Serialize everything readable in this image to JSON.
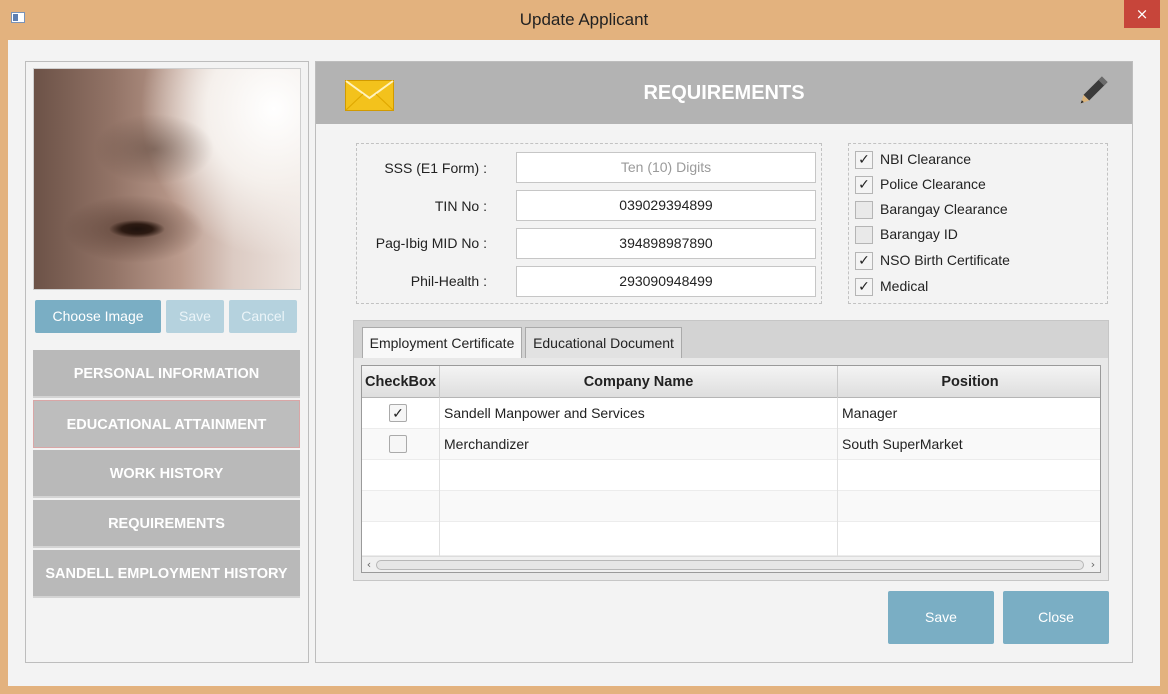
{
  "window": {
    "title": "Update Applicant",
    "close_label": "×"
  },
  "photo": {
    "choose_label": "Choose Image",
    "save_label": "Save",
    "cancel_label": "Cancel"
  },
  "nav": {
    "items": [
      {
        "label": "PERSONAL INFORMATION"
      },
      {
        "label": "EDUCATIONAL ATTAINMENT"
      },
      {
        "label": "WORK HISTORY"
      },
      {
        "label": "REQUIREMENTS"
      },
      {
        "label": "SANDELL EMPLOYMENT HISTORY"
      }
    ]
  },
  "header": {
    "title": "REQUIREMENTS"
  },
  "ids": {
    "sss": {
      "label": "SSS (E1 Form) :",
      "value": "",
      "placeholder": "Ten (10) Digits"
    },
    "tin": {
      "label": "TIN No :",
      "value": "039029394899"
    },
    "pagibig": {
      "label": "Pag-Ibig MID No :",
      "value": "394898987890"
    },
    "philhealth": {
      "label": "Phil-Health :",
      "value": "293090948499"
    }
  },
  "requirements": [
    {
      "label": "NBI Clearance",
      "checked": true,
      "mark": "✓"
    },
    {
      "label": "Police Clearance",
      "checked": true,
      "mark": "✓"
    },
    {
      "label": "Barangay Clearance",
      "checked": false,
      "mark": ""
    },
    {
      "label": "Barangay ID",
      "checked": false,
      "mark": ""
    },
    {
      "label": "NSO Birth Certificate",
      "checked": true,
      "mark": "✓"
    },
    {
      "label": "Medical",
      "checked": true,
      "mark": "✓"
    }
  ],
  "tabs": [
    {
      "label": "Employment Certificate",
      "active": true
    },
    {
      "label": "Educational Document",
      "active": false
    }
  ],
  "table": {
    "columns": [
      "CheckBox",
      "Company Name",
      "Position"
    ],
    "rows": [
      {
        "checked": true,
        "mark": "✓",
        "company": "Sandell Manpower and Services",
        "position": "Manager"
      },
      {
        "checked": false,
        "mark": "",
        "company": "Merchandizer",
        "position": "South SuperMarket"
      }
    ]
  },
  "footer": {
    "save_label": "Save",
    "close_label": "Close"
  },
  "colors": {
    "accent": "#7aaec4",
    "titlebar": "#e3b27e",
    "nav_bg": "#b9b9b9",
    "header_bg": "#b3b3b3",
    "close_red": "#c7453a"
  },
  "icons": {
    "envelope": "envelope-icon",
    "pencil": "pencil-icon",
    "window": "window-icon"
  }
}
